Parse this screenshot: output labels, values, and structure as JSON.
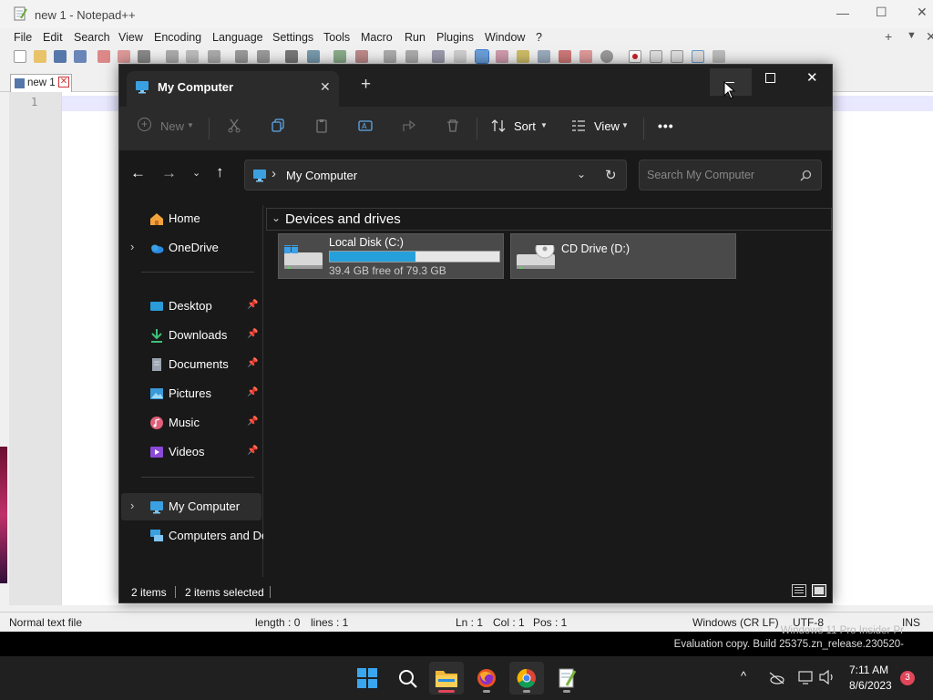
{
  "notepad": {
    "title": "new 1 - Notepad++",
    "menu": [
      "File",
      "Edit",
      "Search",
      "View",
      "Encoding",
      "Language",
      "Settings",
      "Tools",
      "Macro",
      "Run",
      "Plugins",
      "Window",
      "?"
    ],
    "menu_x": [
      15,
      47,
      81,
      130,
      169,
      233,
      299,
      355,
      396,
      444,
      479,
      532,
      588
    ],
    "tab_label": "new 1",
    "line_number": "1",
    "status": {
      "file_type": "Normal text file",
      "length": "length : 0",
      "lines": "lines : 1",
      "ln": "Ln : 1",
      "col": "Col : 1",
      "pos": "Pos : 1",
      "eol": "Windows (CR LF)",
      "encoding": "UTF-8",
      "mode": "INS"
    }
  },
  "explorer": {
    "tab_title": "My Computer",
    "new_tab_glyph": "+",
    "toolbar": {
      "new_label": "New",
      "sort_label": "Sort",
      "view_label": "View",
      "more_label": "•••"
    },
    "address": {
      "separator": "›",
      "crumb": "My Computer"
    },
    "search": {
      "placeholder": "Search My Computer"
    },
    "sidebar": {
      "home": "Home",
      "onedrive": "OneDrive",
      "desktop": "Desktop",
      "downloads": "Downloads",
      "documents": "Documents",
      "pictures": "Pictures",
      "music": "Music",
      "videos": "Videos",
      "mycomputer": "My Computer",
      "network": "Computers and Devices"
    },
    "section_title": "Devices and drives",
    "drives": [
      {
        "name": "Local Disk (C:)",
        "free_text": "39.4 GB free of 79.3 GB",
        "used_fraction": 0.503
      },
      {
        "name": "CD Drive (D:)"
      }
    ],
    "status": {
      "items": "2 items",
      "selected": "2 items selected"
    }
  },
  "watermark": {
    "line1": "Windows 11 Pro Insider Pr",
    "line2": "Evaluation copy. Build 25375.zn_release.230520-"
  },
  "taskbar": {
    "time": "7:11 AM",
    "date": "8/6/2023",
    "notification_count": "3"
  },
  "colors": {
    "accent": "#26a0da",
    "explorer_bg": "#191919",
    "taskbar_bg": "#202020",
    "notification_badge": "#e0465a"
  }
}
